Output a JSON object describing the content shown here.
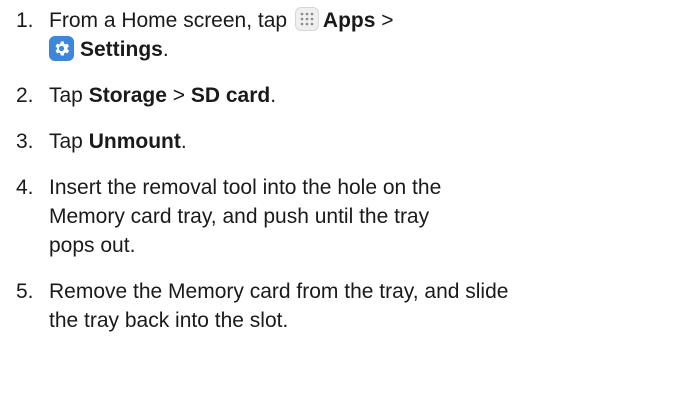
{
  "steps": [
    {
      "number": "1.",
      "parts": {
        "t1": "From a Home screen, tap ",
        "apps_icon": "apps-grid-icon",
        "apps": "Apps",
        "sep": " >",
        "settings_icon": "settings-gear-icon",
        "settings": "Settings",
        "end": "."
      }
    },
    {
      "number": "2.",
      "parts": {
        "t1": "Tap ",
        "b1": "Storage",
        "sep": " > ",
        "b2": "SD card",
        "end": "."
      }
    },
    {
      "number": "3.",
      "parts": {
        "t1": "Tap ",
        "b1": "Unmount",
        "end": "."
      }
    },
    {
      "number": "4.",
      "lines": [
        "Insert the removal tool into the hole on the",
        "Memory card tray, and push until the tray",
        "pops out."
      ]
    },
    {
      "number": "5.",
      "lines": [
        "Remove the Memory card from the tray, and slide",
        "the tray back into the slot."
      ]
    }
  ],
  "colors": {
    "text": "#1a1a1a",
    "settings_icon_bg": "#3d86d9",
    "apps_icon_bg": "#efefef"
  }
}
